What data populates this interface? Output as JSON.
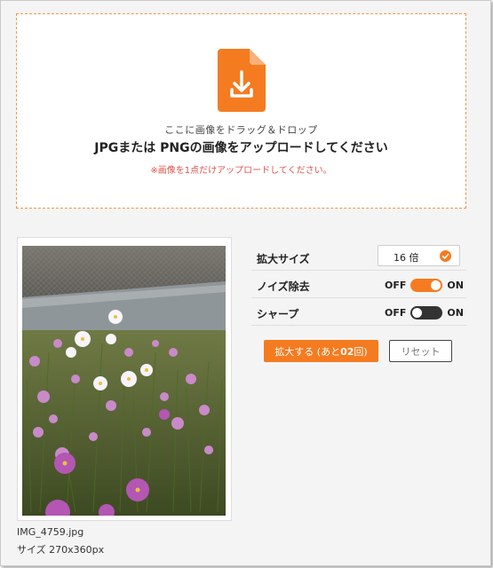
{
  "dropzone": {
    "line1": "ここに画像をドラッグ＆ドロップ",
    "line2": "JPGまたは PNGの画像をアップロードしてください",
    "note": "※画像を1点だけアップロードしてください。",
    "icon": "file-download-icon"
  },
  "image": {
    "file_name": "IMG_4759.jpg",
    "size_text": "サイズ 270x360px"
  },
  "settings": {
    "scale_label": "拡大サイズ",
    "scale_value": "16 倍",
    "noise_label": "ノイズ除去",
    "noise_on": true,
    "sharp_label": "シャープ",
    "sharp_on": false,
    "off_text": "OFF",
    "on_text": "ON"
  },
  "actions": {
    "upscale_prefix": "拡大する (あと",
    "upscale_count": "02",
    "upscale_suffix": "回)",
    "reset_label": "リセット"
  },
  "colors": {
    "accent": "#f47b20",
    "toggle_off": "#333333",
    "note": "#d9534f"
  }
}
